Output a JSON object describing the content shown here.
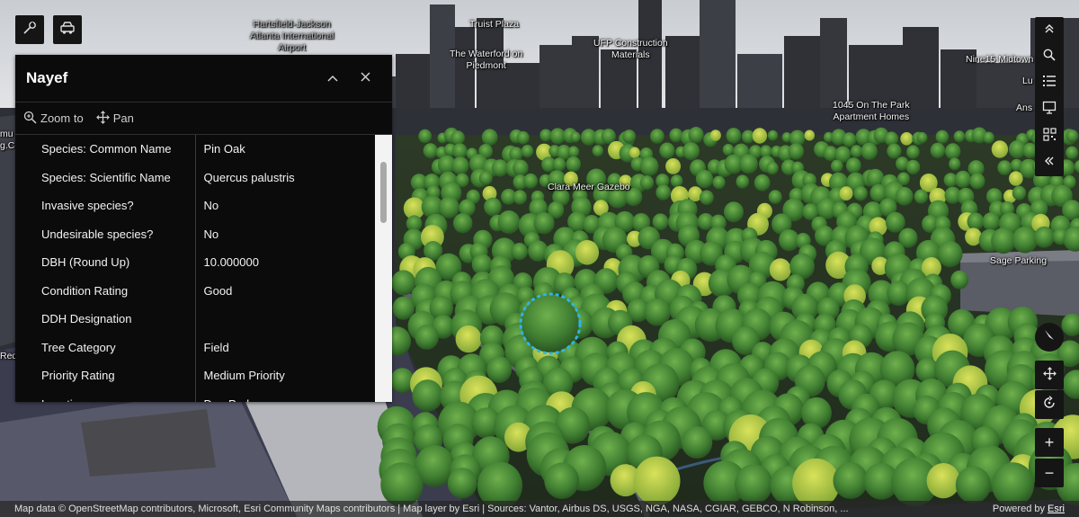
{
  "popup": {
    "title": "Nayef",
    "collapse_icon": "chevron-up-icon",
    "close_icon": "close-icon",
    "actions": [
      {
        "label": "Zoom to",
        "icon": "zoom-in-icon"
      },
      {
        "label": "Pan",
        "icon": "pan-icon"
      }
    ],
    "attributes": [
      {
        "key": "Species: Common Name",
        "value": "Pin Oak"
      },
      {
        "key": "Species: Scientific Name",
        "value": "Quercus palustris"
      },
      {
        "key": "Invasive species?",
        "value": "No"
      },
      {
        "key": "Undesirable species?",
        "value": "No"
      },
      {
        "key": "DBH (Round Up)",
        "value": "10.000000"
      },
      {
        "key": "Condition Rating",
        "value": "Good"
      },
      {
        "key": "DDH Designation",
        "value": ""
      },
      {
        "key": "Tree Category",
        "value": "Field"
      },
      {
        "key": "Priority Rating",
        "value": "Medium Priority"
      },
      {
        "key": "Location",
        "value": "Dog Park"
      }
    ]
  },
  "top_tools": [
    {
      "name": "wrench-icon"
    },
    {
      "name": "car-icon"
    }
  ],
  "right_toolbar": [
    {
      "name": "chevrons-up-icon"
    },
    {
      "name": "search-icon"
    },
    {
      "name": "layer-list-icon"
    },
    {
      "name": "presentation-icon"
    },
    {
      "name": "qr-code-icon"
    },
    {
      "name": "chevrons-left-icon"
    }
  ],
  "nav_controls": [
    {
      "name": "compass-icon"
    },
    {
      "name": "pan-mode-icon"
    },
    {
      "name": "rotate-icon"
    },
    {
      "name": "zoom-in-icon",
      "label": "+"
    },
    {
      "name": "zoom-out-icon",
      "label": "−"
    }
  ],
  "map_labels": {
    "hartsfield": "Hartsfield-Jackson\nAtlanta International\nAirport",
    "truist": "Truist Plaza",
    "waterford": "The Waterford on\nPiedmont",
    "ufp": "UFP Construction\nMaterials",
    "nine15": "Nine15 Midtown",
    "lu": "Lu",
    "ans": "Ans",
    "park1045": "1045 On The Park\nApartment Homes",
    "clara": "Clara Meer Gazebo",
    "sage": "Sage Parking",
    "red": "Red",
    "mu": "mu",
    "gc": "g.C"
  },
  "attribution": {
    "text": "Map data © OpenStreetMap contributors, Microsoft, Esri Community Maps contributors | Map layer by Esri | Sources: Vantor, Airbus DS, USGS, NGA, NASA, CGIAR, GEBCO, N Robinson, ...",
    "powered_by": "Powered by",
    "esri": "Esri"
  },
  "colors": {
    "panel_bg": "#0b0b0b",
    "tree_green": "#4f8f3c",
    "highlight": "#2fb4e8"
  }
}
